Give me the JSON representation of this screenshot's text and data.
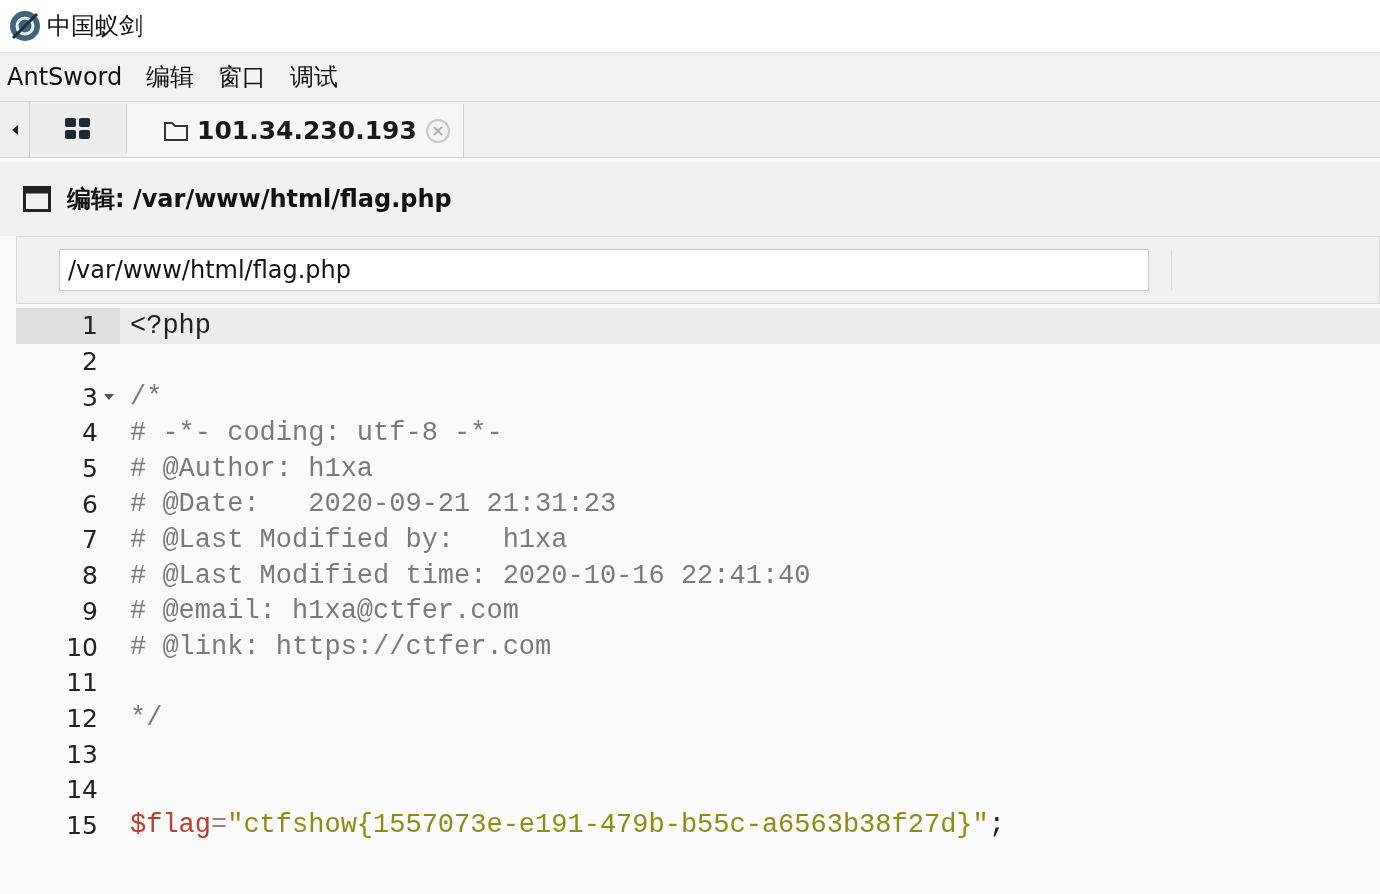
{
  "window": {
    "title": "中国蚁剑"
  },
  "menu": [
    "AntSword",
    "编辑",
    "窗口",
    "调试"
  ],
  "tabs": [
    {
      "kind": "home",
      "selected": false
    },
    {
      "kind": "folder",
      "label": "101.34.230.193",
      "selected": true
    }
  ],
  "panel": {
    "title": "编辑: /var/www/html/flag.php"
  },
  "path_field": {
    "value": "/var/www/html/flag.php"
  },
  "editor": {
    "lines": [
      {
        "number": "1",
        "selected": true,
        "foldable": false,
        "tokens": [
          {
            "kind": "plain",
            "text": "<?php"
          }
        ]
      },
      {
        "number": "2",
        "selected": false,
        "foldable": false
      },
      {
        "number": "3",
        "selected": false,
        "foldable": true,
        "tokens": [
          {
            "kind": "comment",
            "text": "/*"
          }
        ]
      },
      {
        "number": "4",
        "selected": false,
        "foldable": false,
        "tokens": [
          {
            "kind": "comment",
            "text": "# -*- coding: utf-8 -*-"
          }
        ]
      },
      {
        "number": "5",
        "selected": false,
        "foldable": false,
        "tokens": [
          {
            "kind": "comment",
            "text": "# @Author: h1xa"
          }
        ]
      },
      {
        "number": "6",
        "selected": false,
        "foldable": false,
        "tokens": [
          {
            "kind": "comment",
            "text": "# @Date:   2020-09-21 21:31:23"
          }
        ]
      },
      {
        "number": "7",
        "selected": false,
        "foldable": false,
        "tokens": [
          {
            "kind": "comment",
            "text": "# @Last Modified by:   h1xa"
          }
        ]
      },
      {
        "number": "8",
        "selected": false,
        "foldable": false,
        "tokens": [
          {
            "kind": "comment",
            "text": "# @Last Modified time: 2020-10-16 22:41:40"
          }
        ]
      },
      {
        "number": "9",
        "selected": false,
        "foldable": false,
        "tokens": [
          {
            "kind": "comment",
            "text": "# @email: h1xa@ctfer.com"
          }
        ]
      },
      {
        "number": "10",
        "selected": false,
        "foldable": false,
        "tokens": [
          {
            "kind": "comment",
            "text": "# @link: https://ctfer.com"
          }
        ]
      },
      {
        "number": "11",
        "selected": false,
        "foldable": false
      },
      {
        "number": "12",
        "selected": false,
        "foldable": false,
        "tokens": [
          {
            "kind": "comment",
            "text": "*/"
          }
        ]
      },
      {
        "number": "13",
        "selected": false,
        "foldable": false
      },
      {
        "number": "14",
        "selected": false,
        "foldable": false
      },
      {
        "number": "15",
        "selected": false,
        "foldable": false,
        "tokens": [
          {
            "kind": "variable",
            "text": "$flag"
          },
          {
            "kind": "operator",
            "text": "="
          },
          {
            "kind": "string",
            "text": "\"ctfshow{1557073e-e191-479b-b55c-a6563b38f27d}\""
          },
          {
            "kind": "plain",
            "text": ";"
          }
        ]
      }
    ]
  }
}
